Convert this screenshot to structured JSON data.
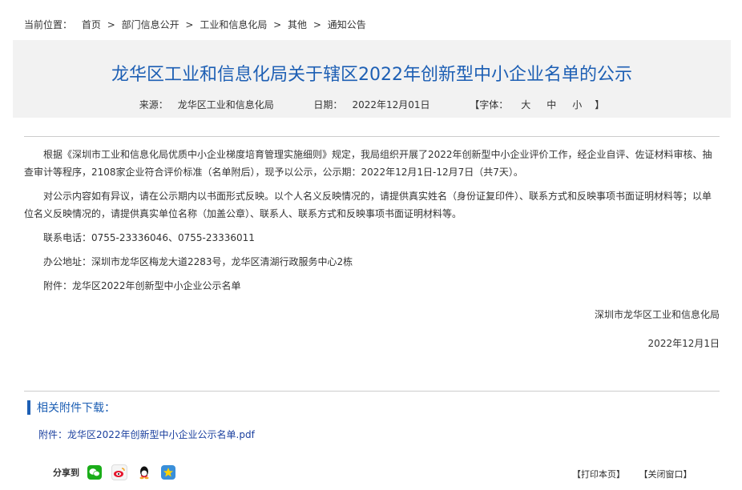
{
  "breadcrumb": {
    "label": "当前位置：",
    "items": [
      "首页",
      "部门信息公开",
      "工业和信息化局",
      "其他",
      "通知公告"
    ],
    "separator": ">"
  },
  "article": {
    "title": "龙华区工业和信息化局关于辖区2022年创新型中小企业名单的公示",
    "meta": {
      "source_label": "来源：",
      "source_value": "龙华区工业和信息化局",
      "date_label": "日期：",
      "date_value": "2022年12月01日",
      "font_label": "【字体：",
      "font_large": "大",
      "font_medium": "中",
      "font_small": "小",
      "font_close": "】"
    },
    "paragraphs": [
      "根据《深圳市工业和信息化局优质中小企业梯度培育管理实施细则》规定，我局组织开展了2022年创新型中小企业评价工作，经企业自评、佐证材料审核、抽查审计等程序，2108家企业符合评价标准（名单附后），现予以公示，公示期：2022年12月1日-12月7日（共7天）。",
      "对公示内容如有异议，请在公示期内以书面形式反映。以个人名义反映情况的，请提供真实姓名（身份证复印件）、联系方式和反映事项书面证明材料等；以单位名义反映情况的，请提供真实单位名称（加盖公章）、联系人、联系方式和反映事项书面证明材料等。",
      "联系电话：0755-23336046、0755-23336011",
      "办公地址：深圳市龙华区梅龙大道2283号，龙华区清湖行政服务中心2栋",
      "附件：龙华区2022年创新型中小企业公示名单"
    ],
    "signature_org": "深圳市龙华区工业和信息化局",
    "signature_date": "2022年12月1日"
  },
  "attachments": {
    "header": "相关附件下载：",
    "items": [
      "附件：龙华区2022年创新型中小企业公示名单.pdf"
    ]
  },
  "share": {
    "label": "分享到",
    "icons": [
      "wechat-icon",
      "weibo-icon",
      "qq-icon",
      "qzone-icon"
    ]
  },
  "actions": {
    "print": "【打印本页】",
    "close": "【关闭窗口】"
  },
  "colors": {
    "title": "#1d5fb4",
    "title_bg": "#f2f2f2",
    "link": "#1a3f9e",
    "wechat": "#1aad19",
    "qzone": "#3a8fd9"
  }
}
